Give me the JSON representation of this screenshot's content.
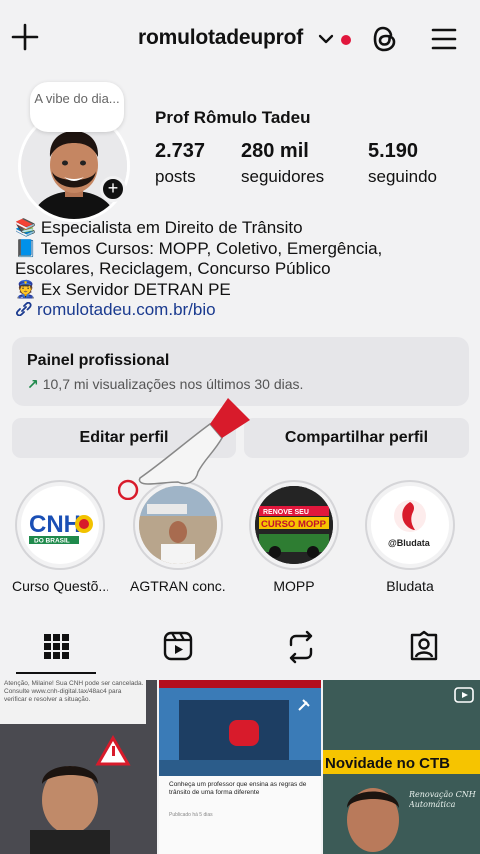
{
  "topbar": {
    "username": "romulotadeuprof",
    "icons": [
      "plus-icon",
      "chevron-down-icon",
      "threads-icon",
      "menu-icon"
    ],
    "notification_color": "#e1173c"
  },
  "profile": {
    "note": "A vibe do dia...",
    "name": "Prof Rômulo Tadeu",
    "stats": {
      "posts_num": "2.737",
      "posts_label": "posts",
      "followers_num": "280 mil",
      "followers_label": "seguidores",
      "following_num": "5.190",
      "following_label": "seguindo"
    }
  },
  "bio": {
    "line1": "📚 Especialista em Direito de Trânsito",
    "line2": "📘 Temos Cursos: MOPP, Coletivo, Emergência,",
    "line3": "Escolares, Reciclagem, Concurso Público",
    "line4": "👮 Ex Servidor DETRAN PE",
    "link": "romulotadeu.com.br/bio"
  },
  "panel": {
    "title": "Painel profissional",
    "subtitle": "10,7 mi visualizações nos últimos 30 dias."
  },
  "buttons": {
    "edit": "Editar perfil",
    "share": "Compartilhar perfil"
  },
  "highlights": [
    {
      "label": "Curso Questõ...",
      "badge_top": "CNH",
      "badge_bottom": "DO BRASIL"
    },
    {
      "label": "AGTRAN conc..."
    },
    {
      "label": "MOPP",
      "banner1": "RENOVE SEU",
      "banner2": "CURSO MOPP"
    },
    {
      "label": "Bludata",
      "handle": "@Bludata"
    }
  ],
  "tabs": [
    "grid-icon",
    "reels-icon",
    "reposts-icon",
    "tagged-icon"
  ],
  "grid": {
    "tile1_text": "Atenção, Milaine! Sua CNH pode ser cancelada. Consulte www.cnh-digital.tax/48ac4 para verificar e resolver a situação.",
    "tile2_caption": "Conheça um professor que ensina as regras de trânsito de uma forma diferente",
    "tile2_meta": "Publicado há 5 dias",
    "tile3_text": "Novidade no CTB",
    "tile3_board": "Renovação CNH Automática"
  },
  "colors": {
    "background": "#f2f2f3",
    "panel": "#e6e6e9",
    "link": "#1a3a8f",
    "trend": "#1f8a4c"
  }
}
